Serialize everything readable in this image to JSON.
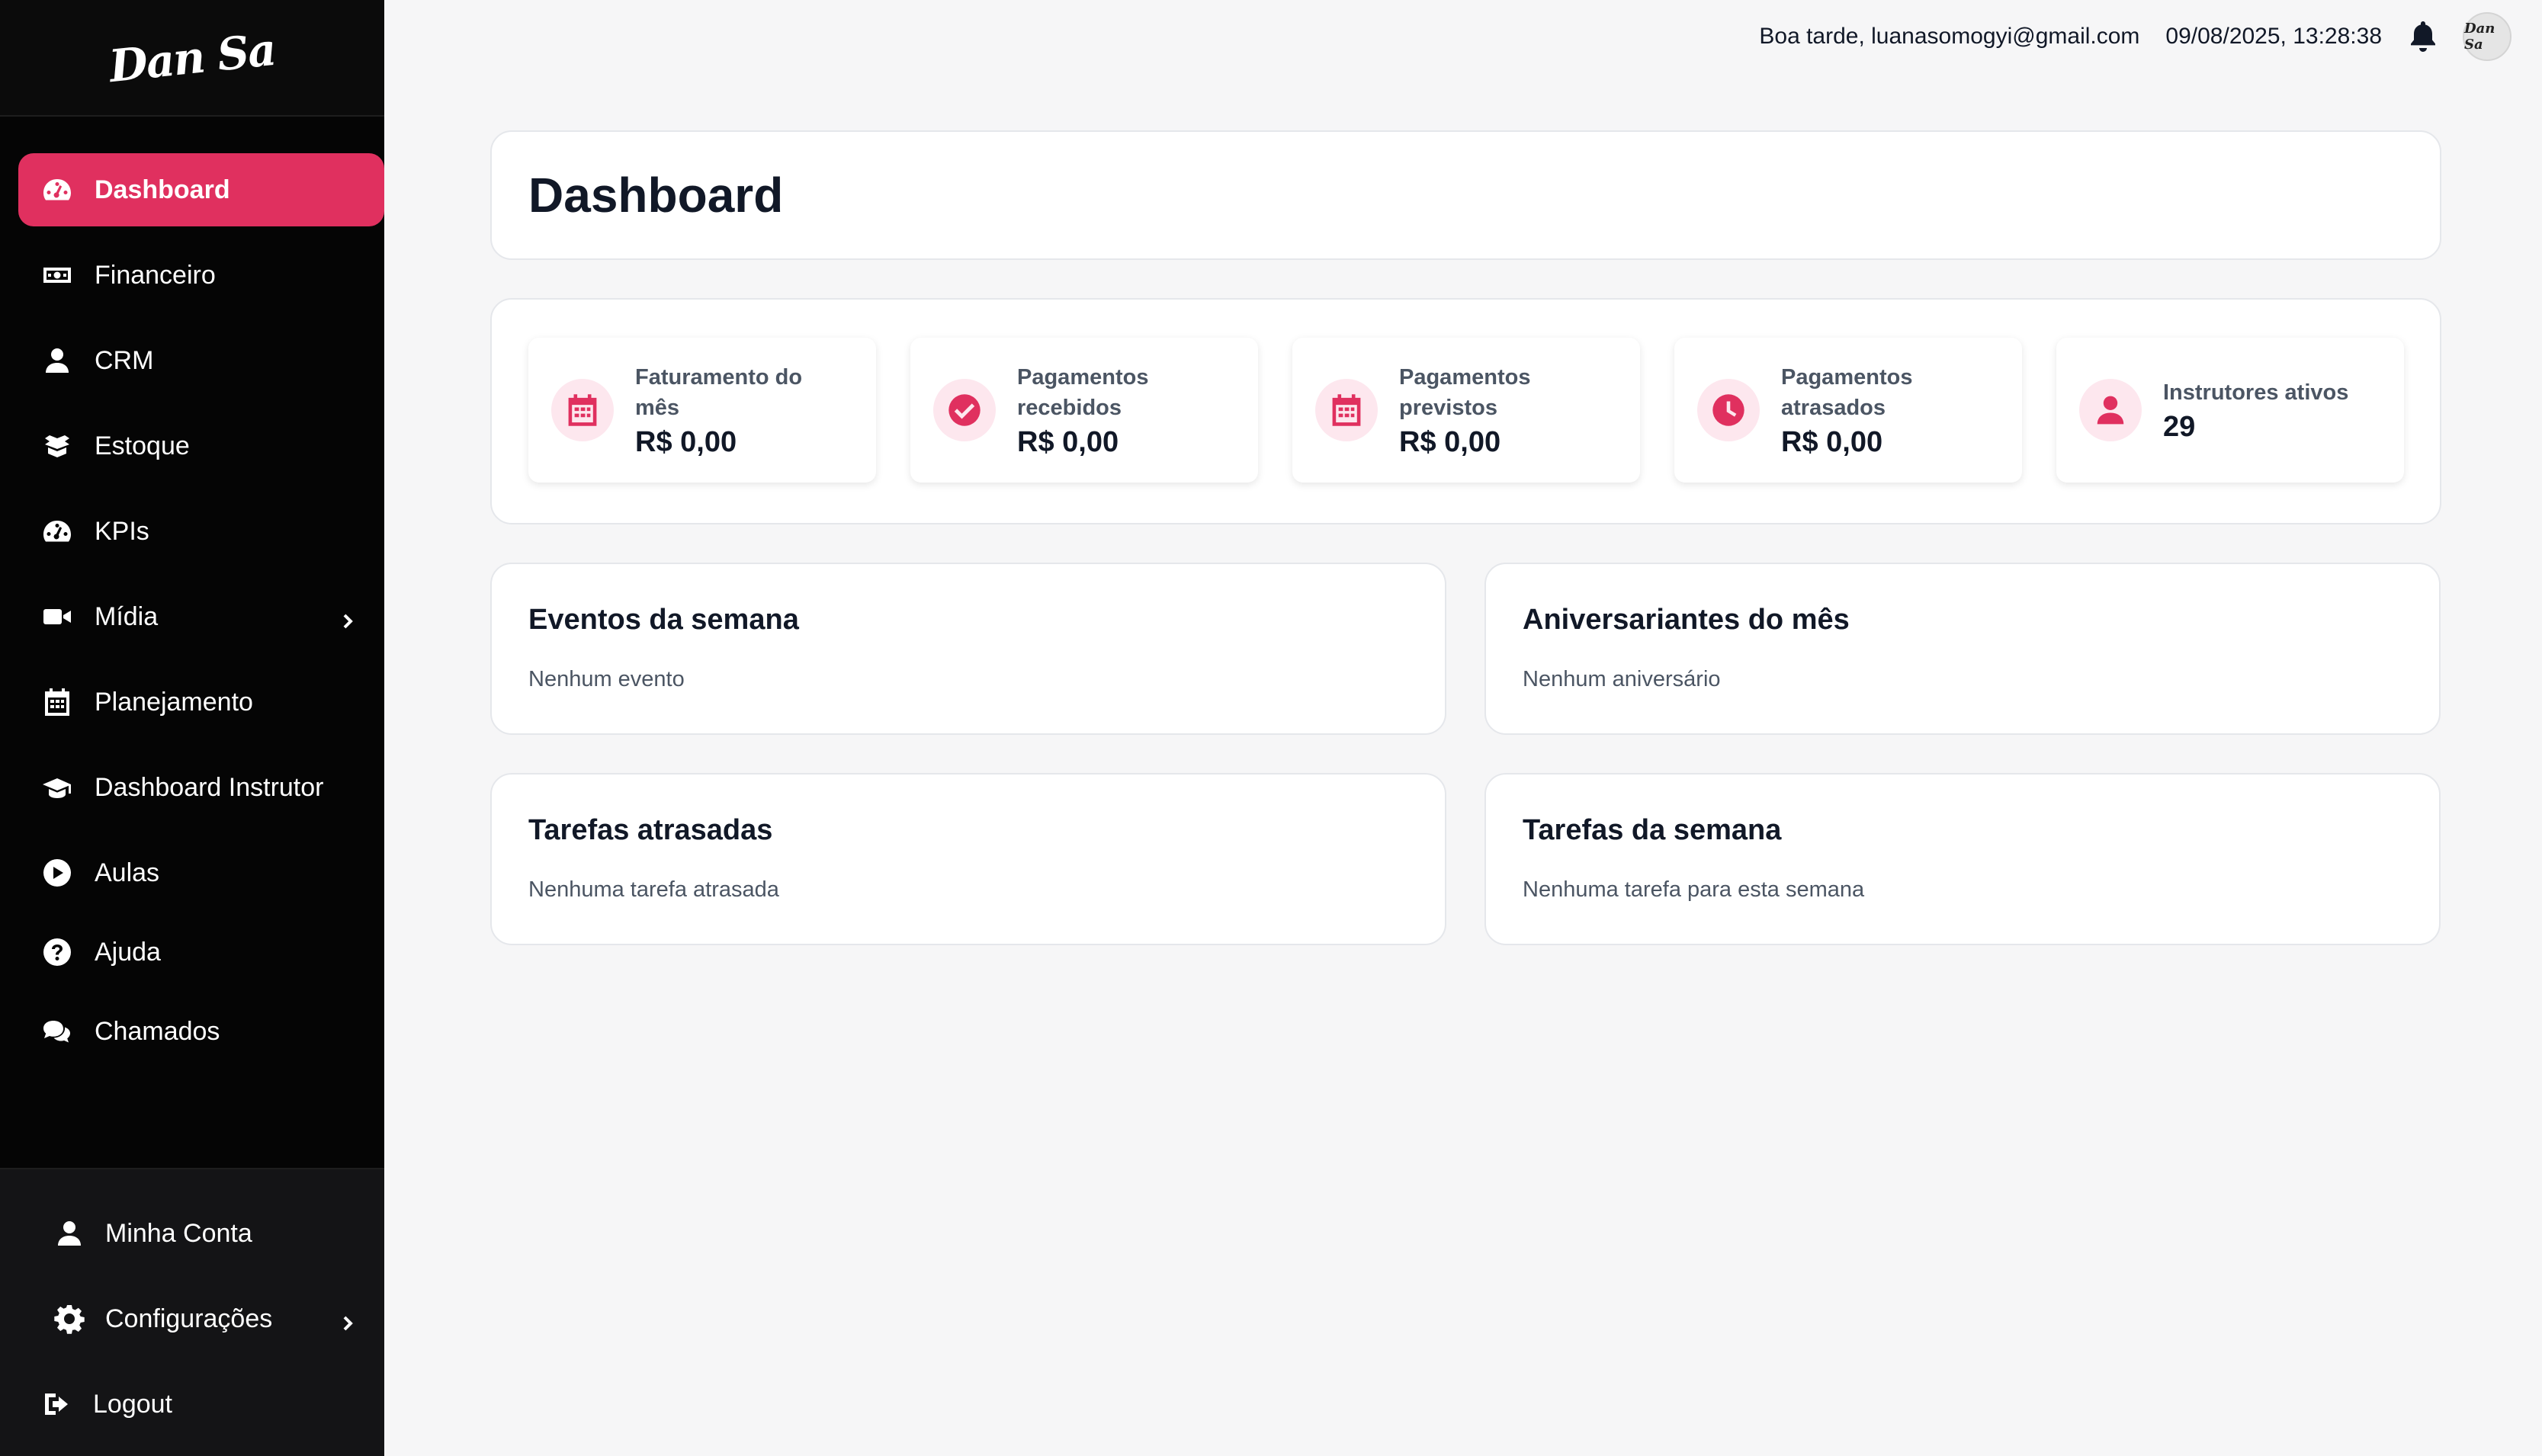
{
  "brand": {
    "logo_text": "Dan Sa"
  },
  "sidebar": {
    "items": [
      {
        "label": "Dashboard",
        "icon": "gauge-icon"
      },
      {
        "label": "Financeiro",
        "icon": "money-icon"
      },
      {
        "label": "CRM",
        "icon": "user-icon"
      },
      {
        "label": "Estoque",
        "icon": "box-icon"
      },
      {
        "label": "KPIs",
        "icon": "gauge-icon"
      },
      {
        "label": "Mídia",
        "icon": "video-icon"
      },
      {
        "label": "Planejamento",
        "icon": "calendar-icon"
      },
      {
        "label": "Dashboard Instrutor",
        "icon": "graduation-cap-icon"
      },
      {
        "label": "Aulas",
        "icon": "play-circle-icon"
      },
      {
        "label": "Ajuda",
        "icon": "question-circle-icon"
      },
      {
        "label": "Chamados",
        "icon": "chat-icon"
      }
    ],
    "bottom": [
      {
        "label": "Minha Conta",
        "icon": "user-icon"
      },
      {
        "label": "Configurações",
        "icon": "gear-icon"
      },
      {
        "label": "Logout",
        "icon": "logout-icon"
      }
    ]
  },
  "header": {
    "greeting": "Boa tarde, luanasomogyi@gmail.com",
    "datetime": "09/08/2025, 13:28:38"
  },
  "page": {
    "title": "Dashboard"
  },
  "stats": [
    {
      "label": "Faturamento do mês",
      "value": "R$ 0,00",
      "icon": "calendar-icon"
    },
    {
      "label": "Pagamentos recebidos",
      "value": "R$ 0,00",
      "icon": "check-circle-icon"
    },
    {
      "label": "Pagamentos previstos",
      "value": "R$ 0,00",
      "icon": "calendar-icon"
    },
    {
      "label": "Pagamentos atrasados",
      "value": "R$ 0,00",
      "icon": "clock-icon"
    },
    {
      "label": "Instrutores ativos",
      "value": "29",
      "icon": "user-icon"
    }
  ],
  "panels": {
    "events": {
      "title": "Eventos da semana",
      "empty": "Nenhum evento"
    },
    "birthdays": {
      "title": "Aniversariantes do mês",
      "empty": "Nenhum aniversário"
    },
    "late_tasks": {
      "title": "Tarefas atrasadas",
      "empty": "Nenhuma tarefa atrasada"
    },
    "week_tasks": {
      "title": "Tarefas da semana",
      "empty": "Nenhuma tarefa para esta semana"
    }
  },
  "colors": {
    "accent": "#e0305f",
    "sidebar_bg": "#050505",
    "page_bg": "#f6f6f7"
  }
}
